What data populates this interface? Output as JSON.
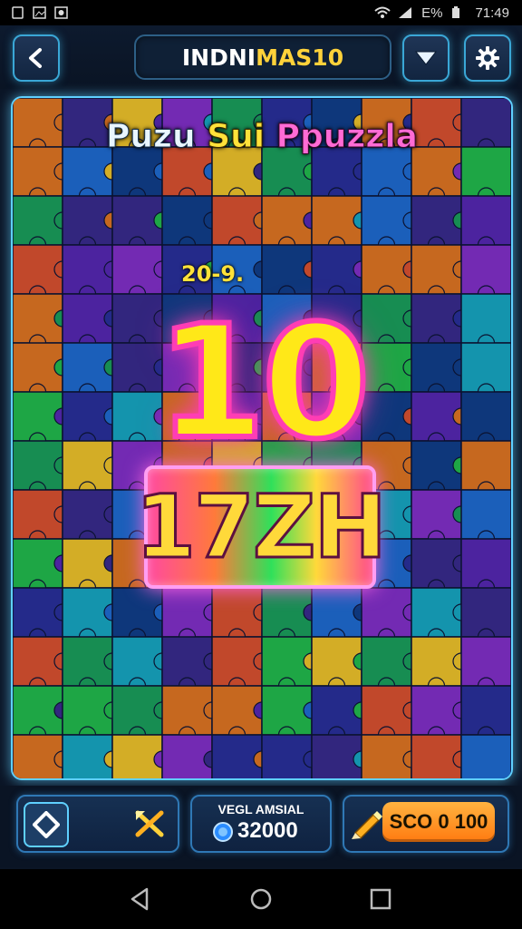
{
  "status_bar": {
    "time": "71:49",
    "battery_text": "E%",
    "icons": [
      "sim-icon",
      "image-icon",
      "photo-icon",
      "wifi-icon",
      "signal-icon",
      "battery-icon"
    ]
  },
  "header": {
    "back_icon": "chevron-left-icon",
    "title_part1": "INDNI",
    "title_part2": "MAS10",
    "dropdown_icon": "triangle-down-icon",
    "settings_icon": "gear-icon"
  },
  "board": {
    "title_part1": "Puzu",
    "title_part2": "Sui",
    "title_part3": "Ppuzzla",
    "sub_count": "20-9.",
    "big_number": "10",
    "word": "17ZH"
  },
  "hud": {
    "left_icon": "diamond-icon",
    "tools_icon": "crossed-tools-icon",
    "coins_label": "VEGL AMSIAL",
    "coins_value": "32000",
    "coin_icon": "coin-icon",
    "score_icon": "pencil-icon",
    "score_label": "SCO 0 100"
  },
  "nav": {
    "back": "back-triangle-icon",
    "home": "home-circle-icon",
    "recents": "recents-square-icon"
  },
  "colors": {
    "accent_cyan": "#5fd0ff",
    "title_yellow": "#ffd23a",
    "glow_pink": "#ff3db4",
    "score_orange": "#ff8a1a"
  }
}
